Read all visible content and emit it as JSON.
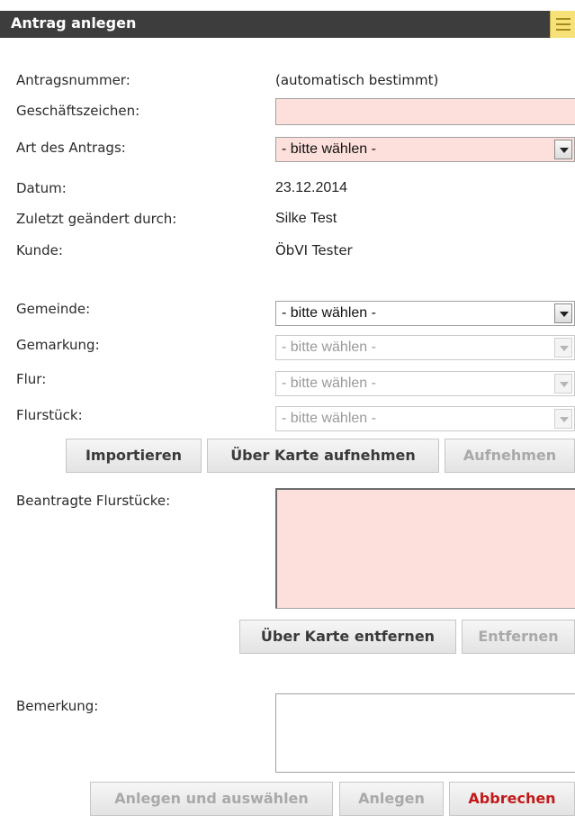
{
  "header": {
    "title": "Antrag anlegen",
    "menu_icon": "hamburger-menu-icon"
  },
  "form": {
    "antragsnummer": {
      "label": "Antragsnummer:",
      "value": "(automatisch bestimmt)"
    },
    "geschaeftszeichen": {
      "label": "Geschäftszeichen:",
      "value": ""
    },
    "art": {
      "label": "Art des Antrags:",
      "value": "- bitte wählen -"
    },
    "datum": {
      "label": "Datum:",
      "value": "23.12.2014"
    },
    "geaendert": {
      "label": "Zuletzt geändert durch:",
      "value": "Silke Test"
    },
    "kunde": {
      "label": "Kunde:",
      "value": "ÖbVI Tester"
    },
    "gemeinde": {
      "label": "Gemeinde:",
      "value": "- bitte wählen -"
    },
    "gemarkung": {
      "label": "Gemarkung:",
      "value": "- bitte wählen -"
    },
    "flur": {
      "label": "Flur:",
      "value": "- bitte wählen -"
    },
    "flurstueck": {
      "label": "Flurstück:",
      "value": "- bitte wählen -"
    },
    "beantragte": {
      "label": "Beantragte Flurstücke:"
    },
    "bemerkung": {
      "label": "Bemerkung:"
    }
  },
  "buttons": {
    "importieren": "Importieren",
    "ueber_karte_aufnehmen": "Über Karte aufnehmen",
    "aufnehmen": "Aufnehmen",
    "ueber_karte_entfernen": "Über Karte entfernen",
    "entfernen": "Entfernen",
    "anlegen_und_auswaehlen": "Anlegen und auswählen",
    "anlegen": "Anlegen",
    "abbrechen": "Abbrechen"
  },
  "colors": {
    "required_field": "#fde0dc",
    "title_bar": "#3d3d3d",
    "danger_text": "#c21a1a",
    "disabled_text": "#a9a9a9"
  }
}
